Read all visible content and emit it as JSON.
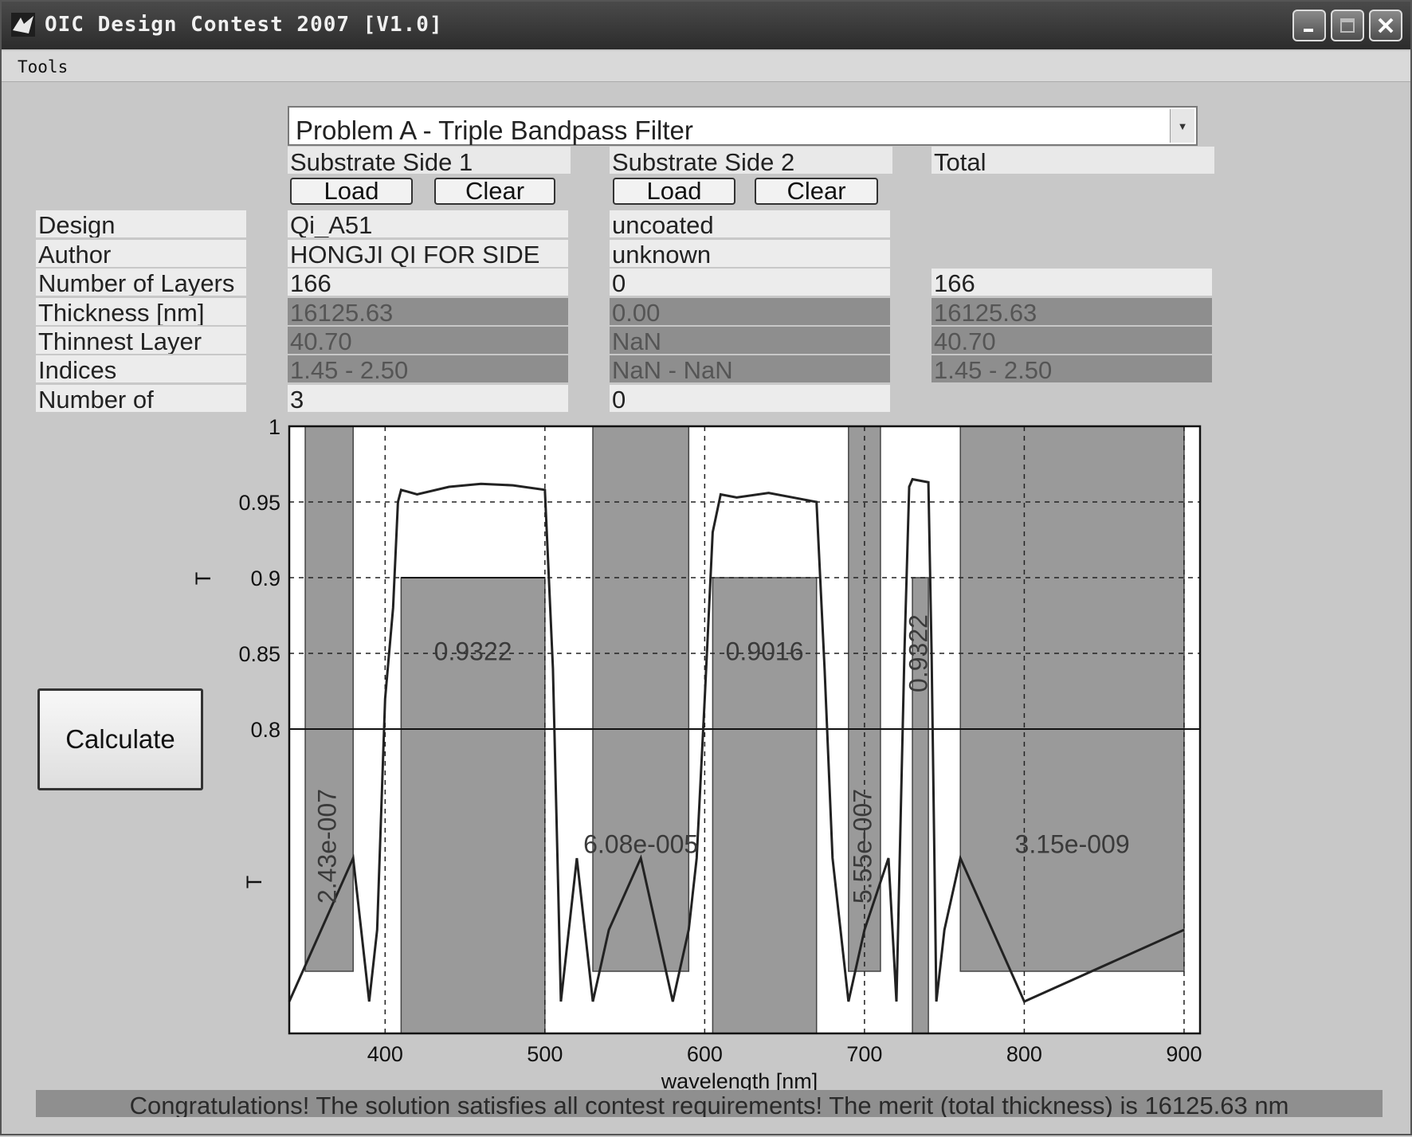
{
  "window": {
    "title": "OIC Design Contest 2007 [V1.0]",
    "minimize_icon": "minimize-icon",
    "maximize_icon": "maximize-icon",
    "close_icon": "close-icon"
  },
  "menu": {
    "tools": "Tools"
  },
  "problem_select": {
    "value": "Problem A - Triple Bandpass Filter"
  },
  "columns": {
    "side1": "Substrate Side 1",
    "side2": "Substrate Side 2",
    "total": "Total"
  },
  "buttons": {
    "load": "Load",
    "clear": "Clear",
    "calculate": "Calculate"
  },
  "rows": {
    "design": {
      "label": "Design",
      "side1": "Qi_A51",
      "side2": "uncoated"
    },
    "author": {
      "label": "Author",
      "side1": "HONGJI QI FOR SIDE",
      "side2": "unknown"
    },
    "layers": {
      "label": "Number of Layers",
      "side1": "166",
      "side2": "0",
      "total": "166"
    },
    "thickness": {
      "label": "Thickness [nm]",
      "side1": "16125.63",
      "side2": "0.00",
      "total": "16125.63"
    },
    "thinnest": {
      "label": "Thinnest Layer",
      "side1": "40.70",
      "side2": "NaN",
      "total": "40.70"
    },
    "indices": {
      "label": "Indices",
      "side1": "1.45 - 2.50",
      "side2": "NaN - NaN",
      "total": "1.45 - 2.50"
    },
    "materials": {
      "label": "Number of",
      "side1": "3",
      "side2": "0"
    }
  },
  "chart_data": {
    "type": "line",
    "xlabel": "wavelength [nm]",
    "ylabel_upper": "T",
    "ylabel_lower": "T",
    "xlim": [
      340,
      910
    ],
    "xticks": [
      "400",
      "500",
      "600",
      "700",
      "800",
      "900"
    ],
    "upper_ylim": [
      0.8,
      1.0
    ],
    "upper_yticks": [
      "0.8",
      "0.85",
      "0.9",
      "0.95",
      "1"
    ],
    "grid": true,
    "spec_boxes": [
      {
        "kind": "passband",
        "x_from": 410,
        "x_to": 500,
        "label": "0.9322"
      },
      {
        "kind": "passband",
        "x_from": 605,
        "x_to": 670,
        "label": "0.9016"
      },
      {
        "kind": "passband",
        "x_from": 730,
        "x_to": 740,
        "label": "0.9322"
      },
      {
        "kind": "blocking",
        "x_from": 350,
        "x_to": 380,
        "label": "2.43e-007"
      },
      {
        "kind": "blocking",
        "x_from": 530,
        "x_to": 590,
        "label": "6.08e-005"
      },
      {
        "kind": "blocking",
        "x_from": 690,
        "x_to": 710,
        "label": "5.55e-007"
      },
      {
        "kind": "blocking",
        "x_from": 760,
        "x_to": 900,
        "label": "3.15e-009"
      }
    ],
    "series": [
      {
        "x": [
          340,
          360,
          380,
          390,
          395,
          400,
          405,
          408,
          410,
          420,
          440,
          460,
          480,
          500,
          505,
          510,
          515,
          520,
          530,
          540,
          560,
          580,
          590,
          595,
          600,
          605,
          610,
          620,
          640,
          660,
          670,
          675,
          680,
          690,
          700,
          715,
          720,
          725,
          728,
          730,
          740,
          742,
          745,
          750,
          760,
          800,
          900
        ],
        "upper_y": [
          null,
          null,
          null,
          null,
          null,
          0.82,
          0.88,
          0.95,
          0.958,
          0.955,
          0.96,
          0.962,
          0.961,
          0.958,
          0.84,
          null,
          null,
          null,
          null,
          null,
          null,
          null,
          null,
          null,
          0.82,
          0.93,
          0.955,
          0.953,
          0.956,
          0.952,
          0.95,
          0.84,
          null,
          null,
          null,
          null,
          null,
          0.85,
          0.96,
          0.965,
          0.963,
          0.85,
          null,
          null,
          null,
          null,
          null
        ]
      }
    ]
  }
}
